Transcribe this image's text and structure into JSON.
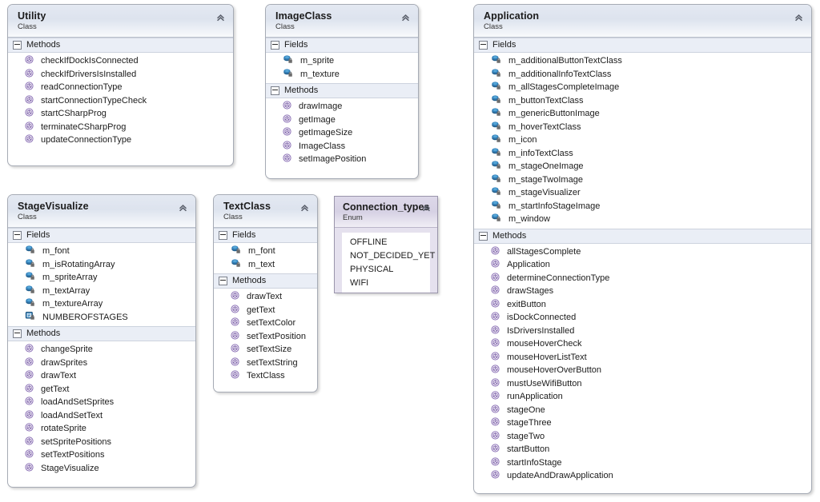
{
  "diagram": {
    "kind": "uml-class-diagram",
    "compartment_labels": {
      "fields": "Fields",
      "methods": "Methods"
    },
    "stereotypes": {
      "class": "Class",
      "enum": "Enum"
    },
    "icons": {
      "collapse": "chevron-double-up-icon",
      "field": "private-field-icon",
      "constant": "private-constant-icon",
      "method": "method-icon",
      "expander": "collapse-expander-icon"
    },
    "colors": {
      "card_border": "#a6abb5",
      "header_gradient_top": "#e4e9f2",
      "header_gradient_bottom": "#f8fafc",
      "compartment_band": "#eaeef6",
      "field_icon": "#2a6fae",
      "method_icon": "#8a6fb5",
      "enum_body": "#e5e1ee",
      "enum_border": "#9a95ab",
      "text": "#1b1b1b"
    }
  },
  "classes": {
    "utility": {
      "name": "Utility",
      "stereotype": "Class",
      "fields": [],
      "methods": [
        "checkIfDockIsConnected",
        "checkIfDriversIsInstalled",
        "readConnectionType",
        "startConnectionTypeCheck",
        "startCSharpProg",
        "terminateCSharpProg",
        "updateConnectionType"
      ]
    },
    "image_class": {
      "name": "ImageClass",
      "stereotype": "Class",
      "fields": [
        "m_sprite",
        "m_texture"
      ],
      "methods": [
        "drawImage",
        "getImage",
        "getImageSize",
        "ImageClass",
        "setImagePosition"
      ]
    },
    "application": {
      "name": "Application",
      "stereotype": "Class",
      "fields": [
        "m_additionalButtonTextClass",
        "m_additionalInfoTextClass",
        "m_allStagesCompleteImage",
        "m_buttonTextClass",
        "m_genericButtonImage",
        "m_hoverTextClass",
        "m_icon",
        "m_infoTextClass",
        "m_stageOneImage",
        "m_stageTwoImage",
        "m_stageVisualizer",
        "m_startInfoStageImage",
        "m_window"
      ],
      "methods": [
        "allStagesComplete",
        "Application",
        "determineConnectionType",
        "drawStages",
        "exitButton",
        "isDockConnected",
        "IsDriversInstalled",
        "mouseHoverCheck",
        "mouseHoverListText",
        "mouseHoverOverButton",
        "mustUseWifiButton",
        "runApplication",
        "stageOne",
        "stageThree",
        "stageTwo",
        "startButton",
        "startInfoStage",
        "updateAndDrawApplication"
      ]
    },
    "stage_visualize": {
      "name": "StageVisualize",
      "stereotype": "Class",
      "fields": [
        "m_font",
        "m_isRotatingArray",
        "m_spriteArray",
        "m_textArray",
        "m_textureArray"
      ],
      "constants": [
        "NUMBEROFSTAGES"
      ],
      "methods": [
        "changeSprite",
        "drawSprites",
        "drawText",
        "getText",
        "loadAndSetSprites",
        "loadAndSetText",
        "rotateSprite",
        "setSpritePositions",
        "setTextPositions",
        "StageVisualize"
      ]
    },
    "text_class": {
      "name": "TextClass",
      "stereotype": "Class",
      "fields": [
        "m_font",
        "m_text"
      ],
      "methods": [
        "drawText",
        "getText",
        "setTextColor",
        "setTextPosition",
        "setTextSize",
        "setTextString",
        "TextClass"
      ]
    },
    "connection_types": {
      "name": "Connection_types",
      "stereotype": "Enum",
      "values": [
        "OFFLINE",
        "NOT_DECIDED_YET",
        "PHYSICAL",
        "WIFI"
      ]
    }
  }
}
